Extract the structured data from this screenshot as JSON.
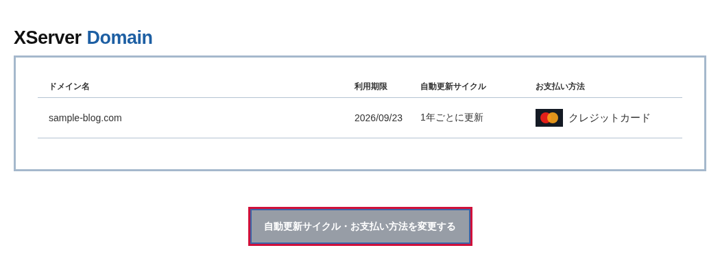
{
  "logo": {
    "primary": "XServer",
    "secondary": "Domain"
  },
  "table": {
    "columns": [
      "ドメイン名",
      "利用期限",
      "自動更新サイクル",
      "お支払い方法"
    ],
    "rows": [
      {
        "domain": "sample-blog.com",
        "expiry": "2026/09/23",
        "cycle": "1年ごとに更新",
        "payment": "クレジットカード"
      }
    ]
  },
  "button": {
    "label": "自動更新サイクル・お支払い方法を変更する",
    "disabled": true
  }
}
